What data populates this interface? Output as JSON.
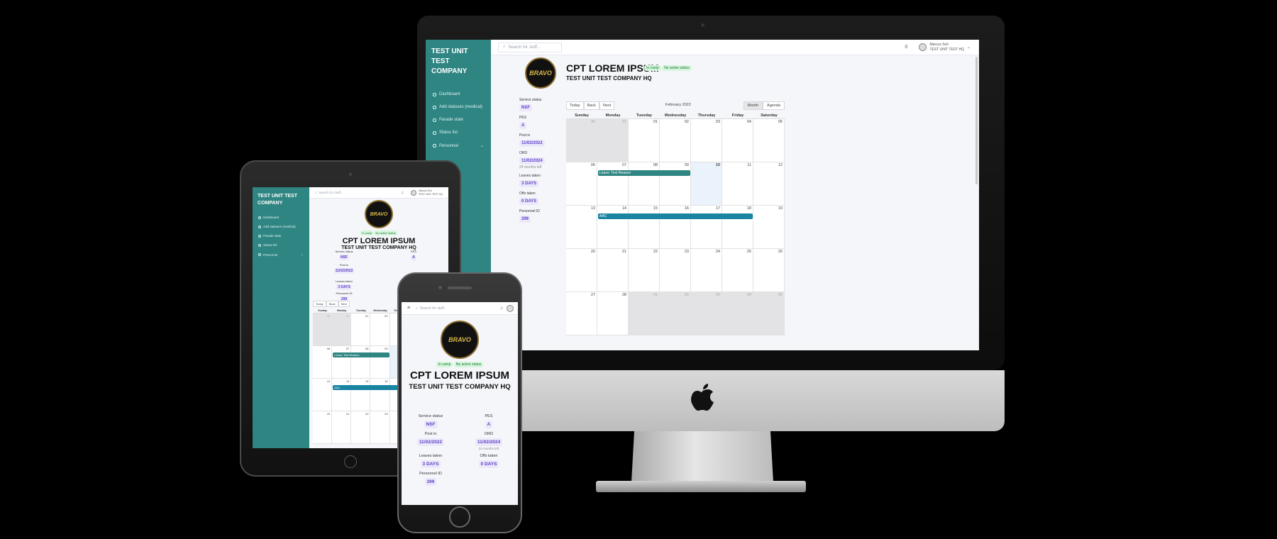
{
  "app": {
    "company": "TEST UNIT TEST COMPANY",
    "search_placeholder": "Search for stuff...",
    "notification_count": "0",
    "user_name": "Marcus Soh",
    "user_unit": "TEST UNIT TEST HQ",
    "nav": [
      {
        "label": "Dashboard",
        "icon": "home-icon"
      },
      {
        "label": "Add statuses (medical)",
        "icon": "plus-icon"
      },
      {
        "label": "Parade state",
        "icon": "clipboard-icon"
      },
      {
        "label": "Status list",
        "icon": "list-icon"
      },
      {
        "label": "Personnel",
        "icon": "users-icon"
      }
    ]
  },
  "profile": {
    "avatar_text": "BRAVO",
    "name": "CPT LOREM IPSUM",
    "unit": "TEST UNIT TEST COMPANY HQ",
    "badge_camp": "In camp",
    "badge_status": "No active status",
    "service_status_label": "Service status",
    "service_status": "NSF",
    "pes_label": "PES",
    "pes": "A",
    "post_in_label": "Post in",
    "post_in": "11/02/2022",
    "ord_label": "ORD",
    "ord": "11/02/2024",
    "ord_note": "24 months left",
    "leaves_label": "Leaves taken",
    "leaves": "3 DAYS",
    "offs_label": "Offs taken",
    "offs": "0 DAYS",
    "pid_label": "Personnel ID",
    "pid": "299"
  },
  "calendar": {
    "btn_today": "Today",
    "btn_back": "Back",
    "btn_next": "Next",
    "month_label": "February 2022",
    "btn_month": "Month",
    "btn_agenda": "Agenda",
    "weekdays": [
      "Sunday",
      "Monday",
      "Tuesday",
      "Wednesday",
      "Thursday",
      "Friday",
      "Saturday"
    ],
    "weeks": [
      [
        "30",
        "31",
        "01",
        "02",
        "03",
        "04",
        "05"
      ],
      [
        "06",
        "07",
        "08",
        "09",
        "10",
        "11",
        "12"
      ],
      [
        "13",
        "14",
        "15",
        "16",
        "17",
        "18",
        "19"
      ],
      [
        "20",
        "21",
        "22",
        "23",
        "24",
        "25",
        "26"
      ],
      [
        "27",
        "28",
        "01",
        "02",
        "03",
        "04",
        "05"
      ]
    ],
    "event_leave": "Leave: Test Reason",
    "event_aac": "AAC"
  },
  "colors": {
    "sidebar": "#2e8582",
    "accent_teal": "#2e8582",
    "accent_blue": "#1a84a3",
    "pill_bg": "#ece8fb",
    "pill_text": "#5b3fc4"
  }
}
